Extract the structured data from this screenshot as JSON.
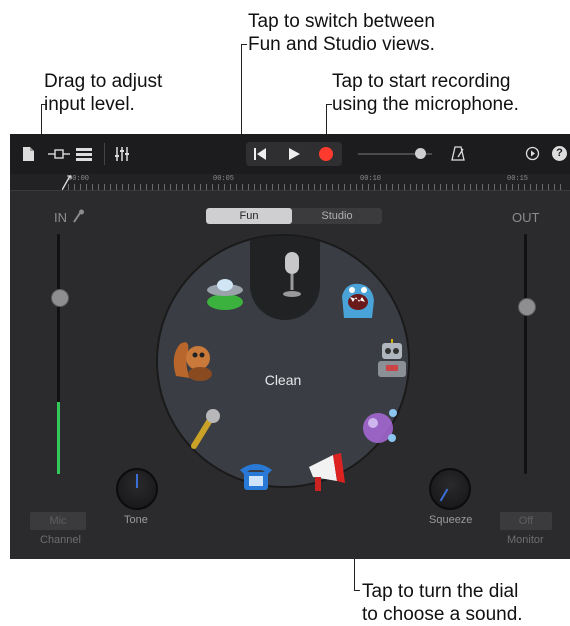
{
  "callouts": {
    "views": "Tap to switch between\nFun and Studio views.",
    "input": "Drag to adjust\ninput level.",
    "record": "Tap to start recording\nusing the microphone.",
    "dial": "Tap to turn the dial\nto choose a sound."
  },
  "toolbar": {
    "info_icon_glyph": "?"
  },
  "ruler": {
    "ticks": [
      "00:00",
      "00:05",
      "00:10",
      "00:15"
    ]
  },
  "view_toggle": {
    "fun_label": "Fun",
    "studio_label": "Studio",
    "selected": "Fun"
  },
  "input_section": {
    "label": "IN",
    "level": 0.4,
    "mic_button": "Mic",
    "channel_label": "Channel"
  },
  "output_section": {
    "label": "OUT",
    "off_button": "Off",
    "monitor_label": "Monitor"
  },
  "dial": {
    "selected_sound": "Clean",
    "sounds": [
      "microphone",
      "monster",
      "robot",
      "bubbles",
      "megaphone",
      "telephone",
      "karaoke-mic",
      "chipmunk",
      "ufo"
    ]
  },
  "knobs": {
    "tone_label": "Tone",
    "squeeze_label": "Squeeze"
  },
  "colors": {
    "record": "#ff3b30",
    "level_meter": "#34c759",
    "panel_bg": "#2b2b2d"
  }
}
